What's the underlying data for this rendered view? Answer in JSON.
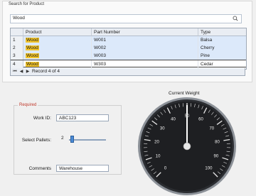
{
  "search": {
    "group_title": "Search for Product",
    "value": "Wood"
  },
  "grid": {
    "headers": {
      "product": "Product",
      "part_number": "Part Number",
      "type": "Type"
    },
    "rows": [
      {
        "num": "1",
        "product": "Wood",
        "part_number": "W001",
        "type": "Balsa"
      },
      {
        "num": "2",
        "product": "Wood",
        "part_number": "W002",
        "type": "Cherry"
      },
      {
        "num": "3",
        "product": "Wood",
        "part_number": "W003",
        "type": "Pine"
      },
      {
        "num": "4",
        "product": "Wood",
        "part_number": "W303",
        "type": "Cedar"
      }
    ],
    "navigator": {
      "record_text": "Record 4 of 4"
    }
  },
  "form": {
    "group_title": "Required",
    "work_id_label": "Work ID:",
    "work_id_value": "ABC123",
    "pallets_label": "Select Pallets:",
    "pallets_value": "2",
    "comments_label": "Comments",
    "comments_value": "Warehouse"
  },
  "gauge": {
    "title": "Current Weight",
    "min": 0,
    "max": 100,
    "value": 50,
    "tick_labels": [
      "0",
      "10",
      "20",
      "30",
      "40",
      "50",
      "60",
      "70",
      "80",
      "90",
      "100"
    ],
    "colors": {
      "face": "#1e1f22",
      "needle": "#ffffff",
      "rim": "#555a60"
    }
  },
  "colors": {
    "highlight": "#f3c52a",
    "selection": "#dce9fa",
    "required": "#c0392b",
    "accent": "#4a8ad6"
  }
}
